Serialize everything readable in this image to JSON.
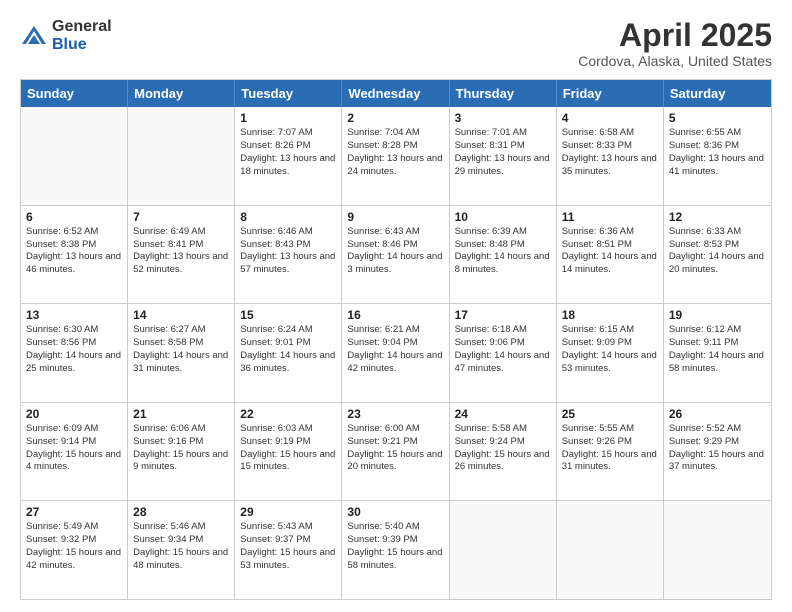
{
  "logo": {
    "general": "General",
    "blue": "Blue"
  },
  "title": "April 2025",
  "subtitle": "Cordova, Alaska, United States",
  "header_days": [
    "Sunday",
    "Monday",
    "Tuesday",
    "Wednesday",
    "Thursday",
    "Friday",
    "Saturday"
  ],
  "rows": [
    [
      {
        "day": "",
        "info": ""
      },
      {
        "day": "",
        "info": ""
      },
      {
        "day": "1",
        "info": "Sunrise: 7:07 AM\nSunset: 8:26 PM\nDaylight: 13 hours and 18 minutes."
      },
      {
        "day": "2",
        "info": "Sunrise: 7:04 AM\nSunset: 8:28 PM\nDaylight: 13 hours and 24 minutes."
      },
      {
        "day": "3",
        "info": "Sunrise: 7:01 AM\nSunset: 8:31 PM\nDaylight: 13 hours and 29 minutes."
      },
      {
        "day": "4",
        "info": "Sunrise: 6:58 AM\nSunset: 8:33 PM\nDaylight: 13 hours and 35 minutes."
      },
      {
        "day": "5",
        "info": "Sunrise: 6:55 AM\nSunset: 8:36 PM\nDaylight: 13 hours and 41 minutes."
      }
    ],
    [
      {
        "day": "6",
        "info": "Sunrise: 6:52 AM\nSunset: 8:38 PM\nDaylight: 13 hours and 46 minutes."
      },
      {
        "day": "7",
        "info": "Sunrise: 6:49 AM\nSunset: 8:41 PM\nDaylight: 13 hours and 52 minutes."
      },
      {
        "day": "8",
        "info": "Sunrise: 6:46 AM\nSunset: 8:43 PM\nDaylight: 13 hours and 57 minutes."
      },
      {
        "day": "9",
        "info": "Sunrise: 6:43 AM\nSunset: 8:46 PM\nDaylight: 14 hours and 3 minutes."
      },
      {
        "day": "10",
        "info": "Sunrise: 6:39 AM\nSunset: 8:48 PM\nDaylight: 14 hours and 8 minutes."
      },
      {
        "day": "11",
        "info": "Sunrise: 6:36 AM\nSunset: 8:51 PM\nDaylight: 14 hours and 14 minutes."
      },
      {
        "day": "12",
        "info": "Sunrise: 6:33 AM\nSunset: 8:53 PM\nDaylight: 14 hours and 20 minutes."
      }
    ],
    [
      {
        "day": "13",
        "info": "Sunrise: 6:30 AM\nSunset: 8:56 PM\nDaylight: 14 hours and 25 minutes."
      },
      {
        "day": "14",
        "info": "Sunrise: 6:27 AM\nSunset: 8:58 PM\nDaylight: 14 hours and 31 minutes."
      },
      {
        "day": "15",
        "info": "Sunrise: 6:24 AM\nSunset: 9:01 PM\nDaylight: 14 hours and 36 minutes."
      },
      {
        "day": "16",
        "info": "Sunrise: 6:21 AM\nSunset: 9:04 PM\nDaylight: 14 hours and 42 minutes."
      },
      {
        "day": "17",
        "info": "Sunrise: 6:18 AM\nSunset: 9:06 PM\nDaylight: 14 hours and 47 minutes."
      },
      {
        "day": "18",
        "info": "Sunrise: 6:15 AM\nSunset: 9:09 PM\nDaylight: 14 hours and 53 minutes."
      },
      {
        "day": "19",
        "info": "Sunrise: 6:12 AM\nSunset: 9:11 PM\nDaylight: 14 hours and 58 minutes."
      }
    ],
    [
      {
        "day": "20",
        "info": "Sunrise: 6:09 AM\nSunset: 9:14 PM\nDaylight: 15 hours and 4 minutes."
      },
      {
        "day": "21",
        "info": "Sunrise: 6:06 AM\nSunset: 9:16 PM\nDaylight: 15 hours and 9 minutes."
      },
      {
        "day": "22",
        "info": "Sunrise: 6:03 AM\nSunset: 9:19 PM\nDaylight: 15 hours and 15 minutes."
      },
      {
        "day": "23",
        "info": "Sunrise: 6:00 AM\nSunset: 9:21 PM\nDaylight: 15 hours and 20 minutes."
      },
      {
        "day": "24",
        "info": "Sunrise: 5:58 AM\nSunset: 9:24 PM\nDaylight: 15 hours and 26 minutes."
      },
      {
        "day": "25",
        "info": "Sunrise: 5:55 AM\nSunset: 9:26 PM\nDaylight: 15 hours and 31 minutes."
      },
      {
        "day": "26",
        "info": "Sunrise: 5:52 AM\nSunset: 9:29 PM\nDaylight: 15 hours and 37 minutes."
      }
    ],
    [
      {
        "day": "27",
        "info": "Sunrise: 5:49 AM\nSunset: 9:32 PM\nDaylight: 15 hours and 42 minutes."
      },
      {
        "day": "28",
        "info": "Sunrise: 5:46 AM\nSunset: 9:34 PM\nDaylight: 15 hours and 48 minutes."
      },
      {
        "day": "29",
        "info": "Sunrise: 5:43 AM\nSunset: 9:37 PM\nDaylight: 15 hours and 53 minutes."
      },
      {
        "day": "30",
        "info": "Sunrise: 5:40 AM\nSunset: 9:39 PM\nDaylight: 15 hours and 58 minutes."
      },
      {
        "day": "",
        "info": ""
      },
      {
        "day": "",
        "info": ""
      },
      {
        "day": "",
        "info": ""
      }
    ]
  ]
}
